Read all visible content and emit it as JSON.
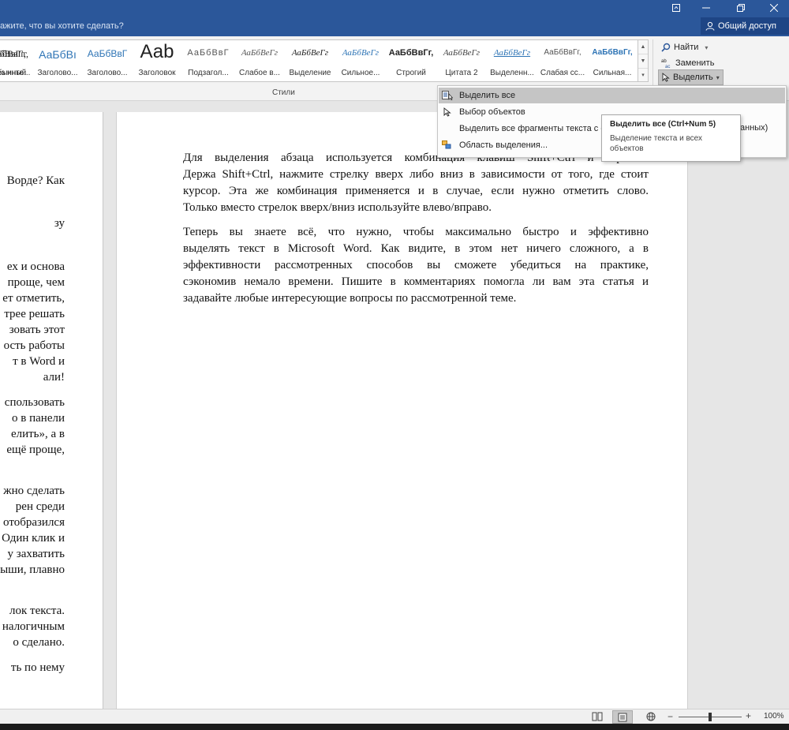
{
  "titlebar": {
    "help_text": "ажите, что вы хотите сделать?",
    "share_label": "Общий доступ",
    "colors": {
      "bar": "#2b579a",
      "share_bg": "#1e4585"
    }
  },
  "ribbon": {
    "styles": [
      {
        "sample": "АаБбВвГг,",
        "name": "¶ Обычный"
      },
      {
        "sample": "АаБбВвГг,",
        "name": "¶ Без инте..."
      },
      {
        "sample": "АаБбВı",
        "name": "Заголово..."
      },
      {
        "sample": "АаБбВвГ",
        "name": "Заголово..."
      },
      {
        "sample": "Ааb",
        "name": "Заголовок"
      },
      {
        "sample": "АаБбВвГ",
        "name": "Подзагол..."
      },
      {
        "sample": "АаБбВеГг",
        "name": "Слабое в..."
      },
      {
        "sample": "АаБбВеГг",
        "name": "Выделение"
      },
      {
        "sample": "АаБбВеГг",
        "name": "Сильное..."
      },
      {
        "sample": "АаБбВвГг,",
        "name": "Строгий"
      },
      {
        "sample": "АаБбВеГг",
        "name": "Цитата 2"
      },
      {
        "sample": "АаБбВеГг",
        "name": "Выделенн..."
      },
      {
        "sample": "АаБбВвГг,",
        "name": "Слабая сс..."
      },
      {
        "sample": "АаБбВвГг,",
        "name": "Сильная..."
      }
    ],
    "group_label": "Стили",
    "editing": {
      "find": "Найти",
      "replace": "Заменить",
      "select": "Выделить"
    }
  },
  "select_menu": {
    "items": [
      {
        "label": "Выделить все",
        "icon": "select-all-icon"
      },
      {
        "label": "Выбор объектов",
        "icon": "cursor-icon"
      },
      {
        "label": "Выделить все фрагменты текста с од",
        "icon": ""
      },
      {
        "label": "Область выделения...",
        "icon": "selection-pane-icon"
      }
    ],
    "overflow_text": "анных)"
  },
  "tooltip": {
    "title": "Выделить все (Ctrl+Num 5)",
    "description": "Выделение текста и всех объектов"
  },
  "document": {
    "left_page_lines": [
      {
        "text": "Ворде? Как",
        "top": 0
      },
      {
        "text": "зу",
        "top": 0
      },
      {
        "text": "ех и основа",
        "top": 0
      },
      {
        "text": "проще, чем",
        "top": 0
      },
      {
        "text": "ет отметить,",
        "top": 0
      },
      {
        "text": "трее решать",
        "top": 0
      },
      {
        "text": "зовать этот",
        "top": 0
      },
      {
        "text": "ость работы",
        "top": 0
      },
      {
        "text": "т в Word и",
        "top": 0
      },
      {
        "text": "али!",
        "top": 0
      },
      {
        "text": "спользовать",
        "top": 0
      },
      {
        "text": "о в панели",
        "top": 0
      },
      {
        "text": "елить», а в",
        "top": 0
      },
      {
        "text": "ещё проще,",
        "top": 0
      },
      {
        "text": "жно сделать",
        "top": 0
      },
      {
        "text": "рен среди",
        "top": 0
      },
      {
        "text": "отобразился",
        "top": 0
      },
      {
        "text": "Один клик и",
        "top": 0
      },
      {
        "text": "у захватить",
        "top": 0
      },
      {
        "text": "ыши, плавно",
        "top": 0
      },
      {
        "text": "лок текста.",
        "top": 0
      },
      {
        "text": "налогичным",
        "top": 0
      },
      {
        "text": "о сделано.",
        "top": 0
      },
      {
        "text": "ть по нему",
        "top": 0
      }
    ],
    "paragraph1": [
      "Для выделения абзаца используется комбинация клавиш Shift+Ctrl и стрелки.",
      "Держа Shift+Ctrl, нажмите стрелку вверх либо вниз в зависимости от того, где стоит",
      "курсор. Эта же комбинация применяется и в случае, если нужно отметить слово.",
      "Только вместо стрелок вверх/вниз используйте влево/вправо."
    ],
    "paragraph2": [
      "Теперь вы знаете всё, что нужно, чтобы максимально быстро и эффективно",
      "выделять текст в Microsoft Word. Как видите, в этом нет ничего сложного, а в",
      "эффективности рассмотренных способов вы сможете убедиться на практике,",
      "сэкономив немало времени. Пишите в комментариях помогла ли вам эта статья и",
      "задавайте любые интересующие вопросы по рассмотренной теме."
    ]
  },
  "statusbar": {
    "zoom": "100%",
    "zoom_level_fraction": 0.5
  }
}
